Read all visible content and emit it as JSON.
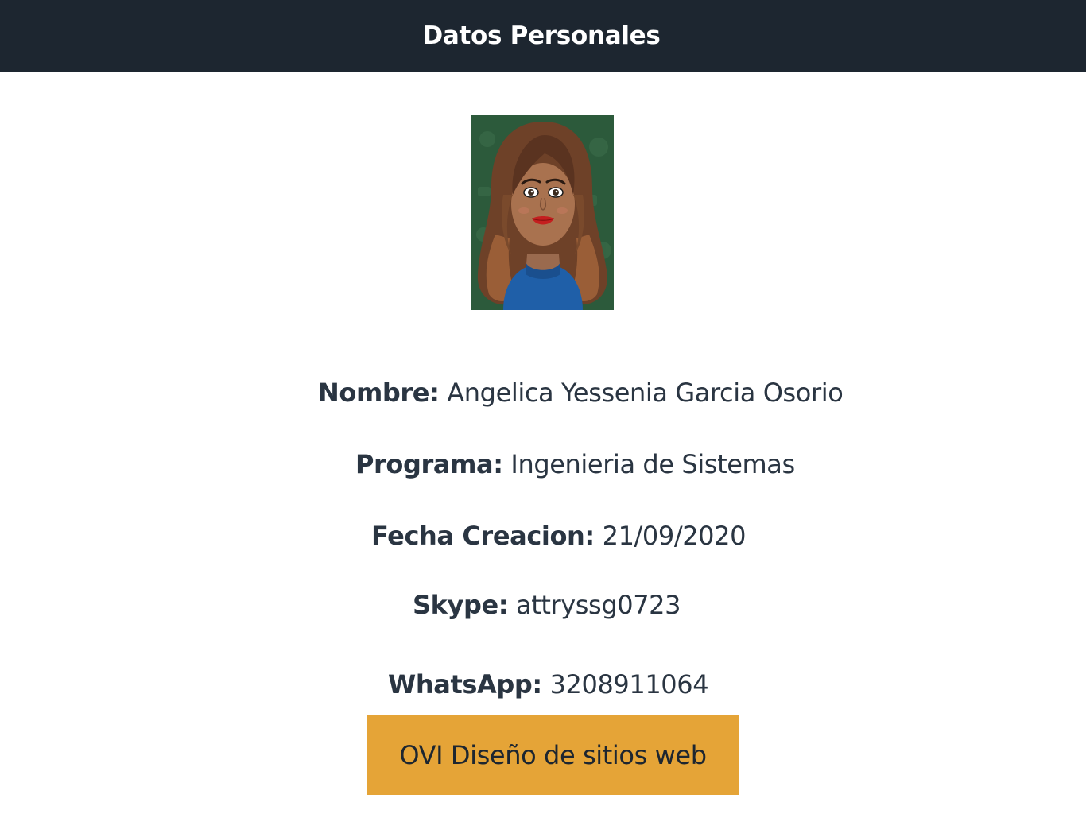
{
  "header": {
    "title": "Datos Personales"
  },
  "profile": {
    "avatar_icon": "avatar-bitmoji-icon",
    "fields": {
      "nombre": {
        "label": "Nombre:",
        "value": "Angelica Yessenia Garcia Osorio"
      },
      "programa": {
        "label": "Programa:",
        "value": "Ingenieria de Sistemas"
      },
      "fecha": {
        "label": "Fecha Creacion:",
        "value": "21/09/2020"
      },
      "skype": {
        "label": "Skype:",
        "value": "attryssg0723"
      },
      "whatsapp": {
        "label": "WhatsApp:",
        "value": "3208911064"
      }
    }
  },
  "action": {
    "label": "OVI Diseño de sitios web"
  },
  "colors": {
    "header_bg": "#1d2630",
    "button_bg": "#e5a437",
    "text": "#2a3542"
  }
}
